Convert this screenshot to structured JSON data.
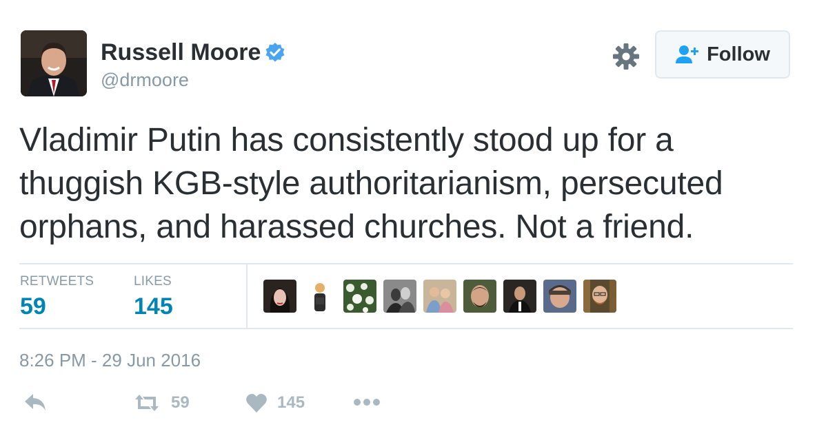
{
  "user": {
    "name": "Russell Moore",
    "handle": "@drmoore"
  },
  "follow_button": {
    "label": "Follow"
  },
  "tweet": {
    "text": "Vladimir Putin has consistently stood up for a thuggish KGB-style authoritarianism, persecuted orphans, and harassed churches. Not a friend."
  },
  "stats": {
    "retweets_label": "RETWEETS",
    "retweets_value": "59",
    "likes_label": "LIKES",
    "likes_value": "145"
  },
  "timestamp": "8:26 PM - 29 Jun 2016",
  "actions": {
    "retweet_count": "59",
    "like_count": "145"
  },
  "colors": {
    "accent_blue": "#0084b4",
    "verified_blue": "#4aa5f0",
    "muted_gray": "#8899a6",
    "icon_gray": "#aab8c2"
  },
  "icons": [
    "verified-badge-icon",
    "gear-icon",
    "follow-person-plus-icon",
    "reply-icon",
    "retweet-icon",
    "heart-icon",
    "more-dots-icon"
  ]
}
